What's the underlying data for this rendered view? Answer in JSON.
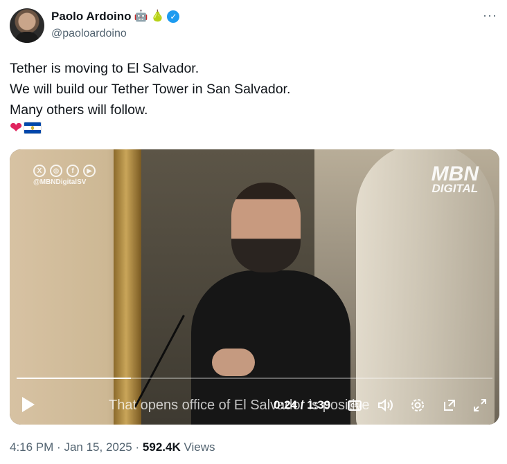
{
  "author": {
    "display_name": "Paolo Ardoino",
    "handle": "@paoloardoino",
    "name_emojis": [
      "🤖",
      "🍐"
    ],
    "verified_icon": "verified-badge-icon",
    "more_icon": "more-options-icon",
    "more_glyph": "···"
  },
  "tweet": {
    "lines": [
      "Tether is moving to El Salvador.",
      "We will build our Tether Tower in San Salvador.",
      "Many others will follow."
    ],
    "emojis": [
      "heart-icon",
      "el-salvador-flag-icon"
    ],
    "heart_glyph": "❤"
  },
  "video": {
    "watermark_left_handle": "@MBNDigitalSV",
    "watermark_left_icons": [
      "x-icon",
      "globe-icon",
      "facebook-icon",
      "youtube-icon"
    ],
    "watermark_right_line1": "MBN",
    "watermark_right_line2": "DIGITAL",
    "caption": "That opens office of El Salvador is positive",
    "time": "0:24 / 1:39",
    "progress": 0.24,
    "controls": [
      "play-icon",
      "closed-captions-icon",
      "volume-icon",
      "settings-icon",
      "pop-out-icon",
      "fullscreen-icon"
    ],
    "cc_label": "CC"
  },
  "meta": {
    "time": "4:16 PM",
    "separator": "·",
    "date": "Jan 15, 2025",
    "views_count": "592.4K",
    "views_label": "Views"
  },
  "colors": {
    "verified": "#1d9bf0",
    "text_primary": "#0f1419",
    "text_secondary": "#536471",
    "heart": "#e0245e"
  }
}
